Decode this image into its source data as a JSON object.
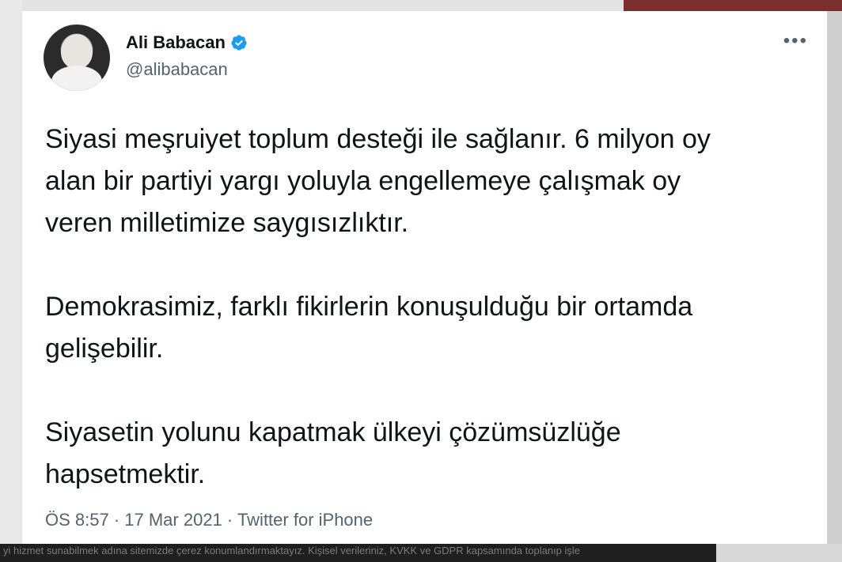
{
  "author": {
    "display_name": "Ali Babacan",
    "handle": "@alibabacan",
    "verified": true
  },
  "tweet": {
    "paragraphs": [
      "Siyasi meşruiyet toplum desteği ile sağlanır. 6 milyon oy\nalan bir partiyi yargı yoluyla engellemeye çalışmak oy\nveren milletimize saygısızlıktır.",
      "Demokrasimiz, farklı fikirlerin konuşulduğu bir ortamda\ngelişebilir.",
      "Siyasetin yolunu kapatmak ülkeyi çözümsüzlüğe\nhapsetmektir."
    ],
    "meta": "ÖS 8:57 · 17 Mar 2021 · Twitter for iPhone"
  },
  "background": {
    "bottom_text": "yi hizmet sunabilmek adına sitemizde çerez konumlandırmaktayız. Kişisel verileriniz, KVKK ve GDPR kapsamında toplanıp işle"
  },
  "colors": {
    "verified_badge": "#1d9bf0",
    "secondary_text": "#536471",
    "primary_text": "#0f1419"
  },
  "icons": {
    "verified": "verified-badge-icon",
    "more": "more-options-icon"
  }
}
